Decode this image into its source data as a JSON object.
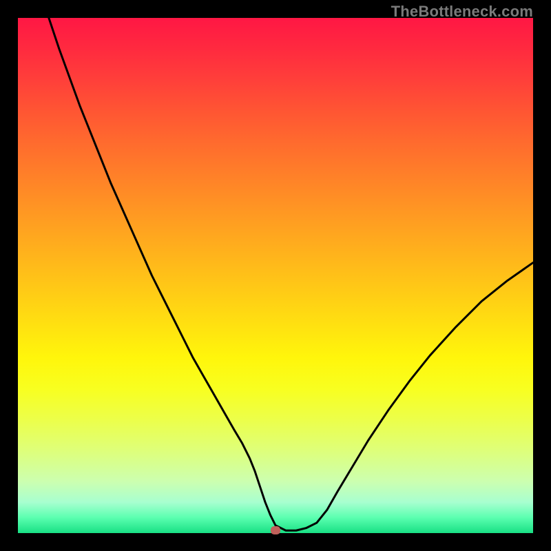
{
  "watermark": "TheBottleneck.com",
  "chart_data": {
    "type": "line",
    "title": "",
    "xlabel": "",
    "ylabel": "",
    "xlim": [
      0,
      100
    ],
    "ylim": [
      0,
      100
    ],
    "legend": false,
    "grid": false,
    "background": "rainbow-gradient-vertical",
    "series": [
      {
        "name": "bottleneck-curve",
        "color": "#000000",
        "x": [
          6,
          8,
          10,
          12,
          14,
          16,
          18,
          20,
          22,
          24,
          26,
          28,
          30,
          32,
          34,
          36,
          38,
          40,
          42,
          43.5,
          45,
          46,
          47,
          48,
          49,
          50,
          52,
          54,
          56,
          58,
          60,
          62,
          65,
          68,
          72,
          76,
          80,
          85,
          90,
          95,
          100
        ],
        "y": [
          100,
          94,
          88.5,
          83,
          78,
          73,
          68,
          63.5,
          59,
          54.5,
          50,
          46,
          42,
          38,
          34,
          30.5,
          27,
          23.5,
          20,
          17.5,
          14.5,
          12,
          9,
          6,
          3.5,
          1.5,
          0.5,
          0.5,
          1,
          2,
          4.5,
          8,
          13,
          18,
          24,
          29.5,
          34.5,
          40,
          45,
          49,
          52.5
        ]
      }
    ],
    "marker": {
      "x": 50,
      "y": 0.5,
      "color": "#c0605a"
    }
  }
}
